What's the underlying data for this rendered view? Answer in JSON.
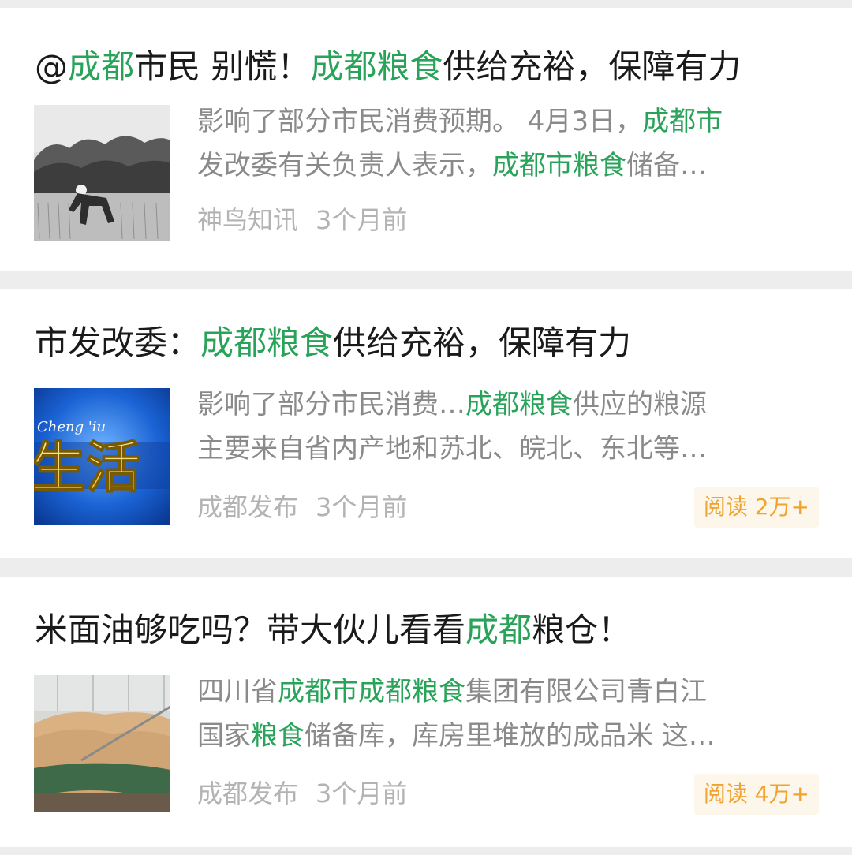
{
  "colors": {
    "background": "#ededed",
    "card": "#ffffff",
    "title_text": "#1a1a1a",
    "snippet_text": "#8a8a8a",
    "highlight": "#2aa35a",
    "meta_text": "#b3b3b3",
    "badge_bg": "#fdf6ea",
    "badge_text": "#f0a330"
  },
  "articles": [
    {
      "title": [
        {
          "text": "@",
          "hl": false
        },
        {
          "text": "成都",
          "hl": true
        },
        {
          "text": "市民 别慌！",
          "hl": false
        },
        {
          "text": "成都粮食",
          "hl": true
        },
        {
          "text": "供给充裕，保障有力",
          "hl": false
        }
      ],
      "snippet": [
        [
          {
            "text": "影响了部分市民消费预期。 4月3日，",
            "hl": false
          },
          {
            "text": "成都市",
            "hl": true
          }
        ],
        [
          {
            "text": "发改委有关负责人表示，",
            "hl": false
          },
          {
            "text": "成都市粮食",
            "hl": true
          },
          {
            "text": "储备…",
            "hl": false
          }
        ]
      ],
      "source": "神鸟知讯",
      "time": "3个月前",
      "thumbnail": "farmer-in-rice-field-image",
      "read_count": null
    },
    {
      "title": [
        {
          "text": "市发改委：",
          "hl": false
        },
        {
          "text": "成都粮食",
          "hl": true
        },
        {
          "text": "供给充裕，保障有力",
          "hl": false
        }
      ],
      "snippet": [
        [
          {
            "text": "影响了部分市民消费…",
            "hl": false
          },
          {
            "text": "成都粮食",
            "hl": true
          },
          {
            "text": "供应的粮源",
            "hl": false
          }
        ],
        [
          {
            "text": "主要来自省内产地和苏北、皖北、东北等…",
            "hl": false
          }
        ]
      ],
      "source": "成都发布",
      "time": "3个月前",
      "thumbnail": "tv-program-life-logo-image",
      "thumbnail_text": {
        "top": "Cheng 'iu",
        "big": "生活"
      },
      "read_count": "阅读 2万+"
    },
    {
      "title": [
        {
          "text": "米面油够吃吗？带大伙儿看看",
          "hl": false
        },
        {
          "text": "成都",
          "hl": true
        },
        {
          "text": "粮仓！",
          "hl": false
        }
      ],
      "snippet": [
        [
          {
            "text": "四川省",
            "hl": false
          },
          {
            "text": "成都市成都粮食",
            "hl": true
          },
          {
            "text": "集团有限公司青白江",
            "hl": false
          }
        ],
        [
          {
            "text": "国家",
            "hl": false
          },
          {
            "text": "粮食",
            "hl": true
          },
          {
            "text": "储备库，库房里堆放的成品米 这…",
            "hl": false
          }
        ]
      ],
      "source": "成都发布",
      "time": "3个月前",
      "thumbnail": "grain-warehouse-image",
      "read_count": "阅读 4万+"
    }
  ]
}
